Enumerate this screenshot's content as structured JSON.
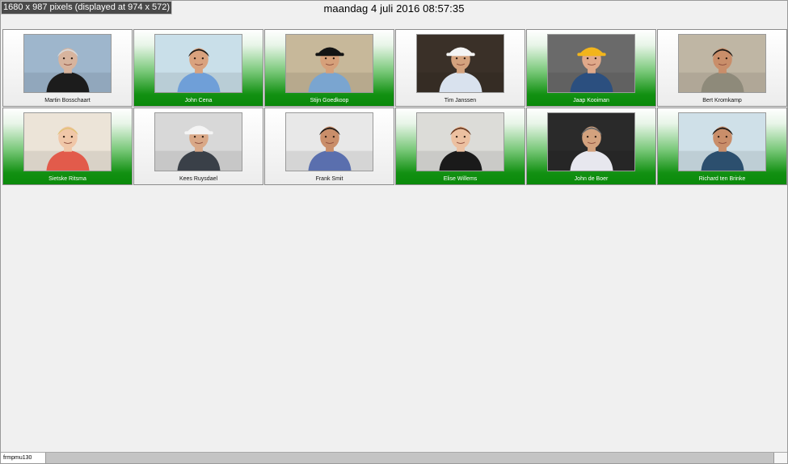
{
  "overlay": {
    "size_text": "1680 x 987 pixels (displayed at 974 x 572)"
  },
  "header": {
    "datetime": "maandag 4 juli 2016 08:57:35"
  },
  "employees": [
    {
      "name": "Martin Bosschaart",
      "active": false,
      "photo": "elderly-man-portrait",
      "sky": "#9eb6cc",
      "shirt": "#1c1c1c",
      "skin": "#d7b49e",
      "hair": "#d8d8d8",
      "helmet": ""
    },
    {
      "name": "John Cena",
      "active": true,
      "photo": "office-worker-with-folders",
      "sky": "#c9dfe9",
      "shirt": "#6f9fd8",
      "skin": "#d9a27e",
      "hair": "#1e1a17",
      "helmet": ""
    },
    {
      "name": "Stijn Goedkoop",
      "active": true,
      "photo": "worker-with-hard-hat-desk",
      "sky": "#c7b89a",
      "shirt": "#7aa5d0",
      "skin": "#d6a07a",
      "hair": "#161616",
      "helmet": "#141414"
    },
    {
      "name": "Tim Janssen",
      "active": false,
      "photo": "construction-worker-white-helmet",
      "sky": "#3a3028",
      "shirt": "#d9e2ee",
      "skin": "#d3a27e",
      "hair": "#3b2a1e",
      "helmet": "#f4f4f4"
    },
    {
      "name": "Jaap Kooiman",
      "active": true,
      "photo": "worker-yellow-helmet-headset",
      "sky": "#6a6a6a",
      "shirt": "#2b4f7f",
      "skin": "#e0a98a",
      "hair": "#3b2a1e",
      "helmet": "#f2b51c"
    },
    {
      "name": "Bert Kromkamp",
      "active": false,
      "photo": "man-in-office-portrait",
      "sky": "#bfb6a4",
      "shirt": "#8e8a7a",
      "skin": "#c98e6a",
      "hair": "#1e1a17",
      "helmet": ""
    },
    {
      "name": "Sietske Ritsma",
      "active": true,
      "photo": "woman-at-desk",
      "sky": "#ece4d8",
      "shirt": "#e25b4b",
      "skin": "#f0c7a8",
      "hair": "#e3c27a",
      "helmet": ""
    },
    {
      "name": "Kees Ruysdael",
      "active": false,
      "photo": "worker-with-blueprints",
      "sky": "#d8d8d8",
      "shirt": "#3a4048",
      "skin": "#d9a887",
      "hair": "#3b2a1e",
      "helmet": "#f4f4f4"
    },
    {
      "name": "Frank Smit",
      "active": false,
      "photo": "architect-at-drawing-table",
      "sky": "#e8e8e8",
      "shirt": "#5a6fae",
      "skin": "#c98e6a",
      "hair": "#1e1a17",
      "helmet": ""
    },
    {
      "name": "Elise Willems",
      "active": true,
      "photo": "woman-with-headset",
      "sky": "#dcdcd8",
      "shirt": "#1a1a1a",
      "skin": "#ecc0a0",
      "hair": "#6b3b22",
      "helmet": ""
    },
    {
      "name": "John de Boer",
      "active": true,
      "photo": "businessman-at-desk",
      "sky": "#2a2a2a",
      "shirt": "#e7e7ee",
      "skin": "#d3a27e",
      "hair": "#6a6a6a",
      "helmet": ""
    },
    {
      "name": "Richard ten Brinke",
      "active": true,
      "photo": "engineer-in-workshop",
      "sky": "#cfe0e8",
      "shirt": "#2c4f6e",
      "skin": "#c98e6a",
      "hair": "#1e1a17",
      "helmet": ""
    }
  ],
  "statusbar": {
    "form_name": "frmpmu130"
  }
}
